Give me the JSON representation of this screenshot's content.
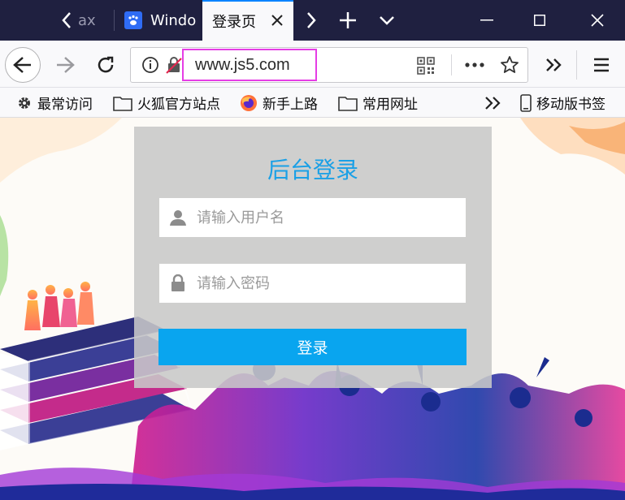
{
  "tabs": {
    "partial_tab_label": "ax",
    "baidu_tab_label": "Windo",
    "active_tab_label": "登录页"
  },
  "address_bar": {
    "url": "www.js5.com"
  },
  "bookmarks": [
    {
      "label": "最常访问",
      "icon": "gear-icon"
    },
    {
      "label": "火狐官方站点",
      "icon": "folder-icon"
    },
    {
      "label": "新手上路",
      "icon": "firefox-icon"
    },
    {
      "label": "常用网址",
      "icon": "folder-icon"
    },
    {
      "label": "移动版书签",
      "icon": "mobile-icon"
    }
  ],
  "login": {
    "title": "后台登录",
    "username_placeholder": "请输入用户名",
    "password_placeholder": "请输入密码",
    "button_label": "登录"
  },
  "colors": {
    "accent": "#09a5ef",
    "title": "#1aa0e6",
    "tabbar": "#1f2040",
    "url_highlight": "#e53de5"
  }
}
